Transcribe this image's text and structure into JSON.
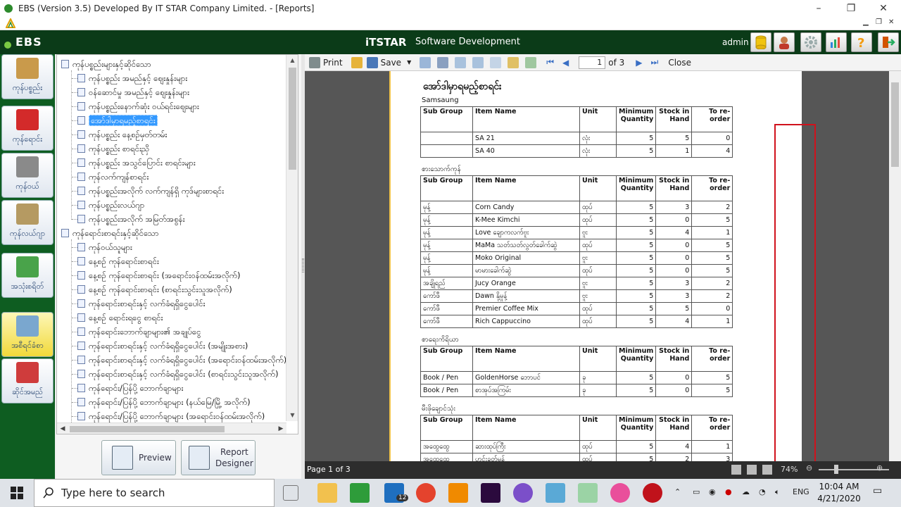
{
  "window": {
    "title": "EBS (Version 3.5) Developed By IT STAR Company Limited. - [Reports]",
    "minimize": "–",
    "restore": "❐",
    "close": "✕"
  },
  "header": {
    "brand": "EBS",
    "center_brand": "iTSTAR",
    "center_tagline": "Software Development",
    "user": "admin"
  },
  "leftnav": [
    {
      "label": "ကုန်ပစ္စည်း",
      "icon": "box-icon",
      "color": "#c99a4b"
    },
    {
      "label": "ကုန်ရောင်း",
      "icon": "shopping-bag-icon",
      "color": "#d32a2a"
    },
    {
      "label": "ကုန်ဝယ်",
      "icon": "cart-icon",
      "color": "#8a8a8a"
    },
    {
      "label": "ကုန်လယ်ဂျာ",
      "icon": "ledger-icon",
      "color": "#b59a62"
    },
    {
      "label": "အသုံးစရိတ်",
      "icon": "money-icon",
      "color": "#49a34a"
    },
    {
      "label": "အစီရင်ခံစာ",
      "icon": "reports-icon",
      "color": "#7aa7cf"
    },
    {
      "label": "ဆိုင်အမည်",
      "icon": "shop-icon",
      "color": "#cf3c3c"
    }
  ],
  "tree": {
    "group1": "ကုန်ပစ္စည်းများနှင့်ဆိုင်သော",
    "items1": [
      "ကုန်ပစ္စည်း အမည်နှင့် ဈေးနှုန်းများ",
      "ဝန်ဆောင်မှု အမည်နှင့် ဈေးနှုန်းများ",
      "ကုန်ပစ္စည်းနောက်ဆုံး ဝယ်ရင်းဈေးများ",
      "အော်ဒါမှာရမည့်စာရင်း",
      "ကုန်ပစ္စည်း နေ့စဉ်မှတ်တမ်း",
      "ကုန်ပစ္စည်း စာရင်းညှိ",
      "ကုန်ပစ္စည်း အသွင်ပြောင်း စာရင်းများ",
      "ကုန်လက်ကျန်စာရင်း",
      "ကုန်ပစ္စည်းအလိုက် လက်ကျန်ရှိ ကုဒ်များစာရင်း",
      "ကုန်ပစ္စည်းလယ်ဂျာ",
      "ကုန်ပစ္စည်းအလိုက် အမြတ်အစွန်း"
    ],
    "group2": "ကုန်ရောင်းစာရင်းနှင့်ဆိုင်သော",
    "items2": [
      "ကုန်ဝယ်သူများ",
      "နေ့စဉ် ကုန်ရောင်းစာရင်း",
      "နေ့စဉ် ကုန်ရောင်းစာရင်း (အရောင်းဝန်ထမ်းအလိုက်)",
      "နေ့စဉ် ကုန်ရောင်းစာရင်း (စာရင်းသွင်းသူအလိုက်)",
      "ကုန်ရောင်းစာရင်းနှင့် လက်ခံရရှိငွေပေါင်း",
      "နေ့စဉ် ရောင်းရငွေ စာရင်း",
      "ကုန်ရောင်းဘောက်ချာများ၏ အချုပ်ငွေ",
      "ကုန်ရောင်းစာရင်းနှင့် လက်ခံရရှိငွေပေါင်း (အမျိုးအစား)",
      "ကုန်ရောင်းစာရင်းနှင့် လက်ခံရရှိငွေပေါင်း (အရောင်းဝန်ထမ်းအလိုက်)",
      "ကုန်ရောင်းစာရင်းနှင့် လက်ခံရရှိငွေပေါင်း (စာရင်းသွင်းသူအလိုက်)",
      "ကုန်ရောင်း/ပြန်ပို့ ဘောက်ချာများ",
      "ကုန်ရောင်း/ပြန်ပို့ ဘောက်ချာများ (နယ်မြေ/မြို့ အလိုက်)",
      "ကုန်ရောင်း/ပြန်ပို့ ဘောက်ချာများ (အရောင်းဝန်ထမ်းအလိုက်)"
    ],
    "selected_index": 3
  },
  "buttons": {
    "preview": "Preview",
    "designer_line1": "Report",
    "designer_line2": "Designer"
  },
  "toolbar": {
    "print": "Print",
    "save": "Save",
    "page_value": "1",
    "of_pages": "of 3",
    "close": "Close"
  },
  "report": {
    "title": "အော်ဒါမှာရမည့်စာရင်း",
    "subtitle": "Samsaung",
    "headers": [
      "Sub Group",
      "Item Name",
      "Unit",
      "Minimum Quantity",
      "Stock in Hand",
      "To re-order"
    ],
    "groups": [
      {
        "name": "",
        "rows": [
          [
            "",
            "SA 21",
            "လုံး",
            "5",
            "5",
            "0"
          ],
          [
            "",
            "SA 40",
            "လုံး",
            "5",
            "1",
            "4"
          ]
        ]
      },
      {
        "name": "စားသောက်ကုန်",
        "rows": [
          [
            "မုန့်",
            "Corn Candy",
            "ထုပ်",
            "5",
            "3",
            "2"
          ],
          [
            "မုန့်",
            "K-Mee Kimchi",
            "ထုပ်",
            "5",
            "0",
            "5"
          ],
          [
            "မုန့်",
            "Love ချောကလက်ဗူး",
            "ဗူး",
            "5",
            "4",
            "1"
          ],
          [
            "မုန့်",
            "MaMa သတ်သတ်လွတ်ခေါက်ဆွဲ",
            "ထုပ်",
            "5",
            "0",
            "5"
          ],
          [
            "မုန့်",
            "Moko Original",
            "ဗူး",
            "5",
            "0",
            "5"
          ],
          [
            "မုန့်",
            "မာမားခေါက်ဆွဲ",
            "ထုပ်",
            "5",
            "0",
            "5"
          ],
          [
            "အချိုရည်",
            "Jucy Orange",
            "ဗူး",
            "5",
            "3",
            "2"
          ],
          [
            "ကော်ဖီ",
            "Dawn နို့မှုန့်",
            "ဗူး",
            "5",
            "3",
            "2"
          ],
          [
            "ကော်ဖီ",
            "Premier Coffee Mix",
            "ထုပ်",
            "5",
            "5",
            "0"
          ],
          [
            "ကော်ဖီ",
            "Rich Cappuccino",
            "ထုပ်",
            "5",
            "4",
            "1"
          ]
        ]
      },
      {
        "name": "စာရေးကိရိယာ",
        "rows": [
          [
            "Book / Pen",
            "GoldenHorse ဘောပင်",
            "ခု",
            "5",
            "0",
            "5"
          ],
          [
            "Book / Pen",
            "စာအုပ်အကြမ်း",
            "ခု",
            "5",
            "0",
            "5"
          ]
        ]
      },
      {
        "name": "မီးဖိုချောင်သုံး",
        "rows": [
          [
            "အထွေထွေ",
            "ဆားထုပ်ကြီး",
            "ထုပ်",
            "5",
            "4",
            "1"
          ],
          [
            "အထွေထွေ",
            "ဟင်းခတ်မှုန့်",
            "ထုပ်",
            "5",
            "2",
            "3"
          ]
        ]
      }
    ]
  },
  "status": {
    "page_text": "Page 1 of 3",
    "zoom": "74%"
  },
  "taskbar": {
    "search_placeholder": "Type here to search",
    "mail_badge": "12",
    "lang": "ENG",
    "time": "10:04 AM",
    "date": "4/21/2020"
  }
}
